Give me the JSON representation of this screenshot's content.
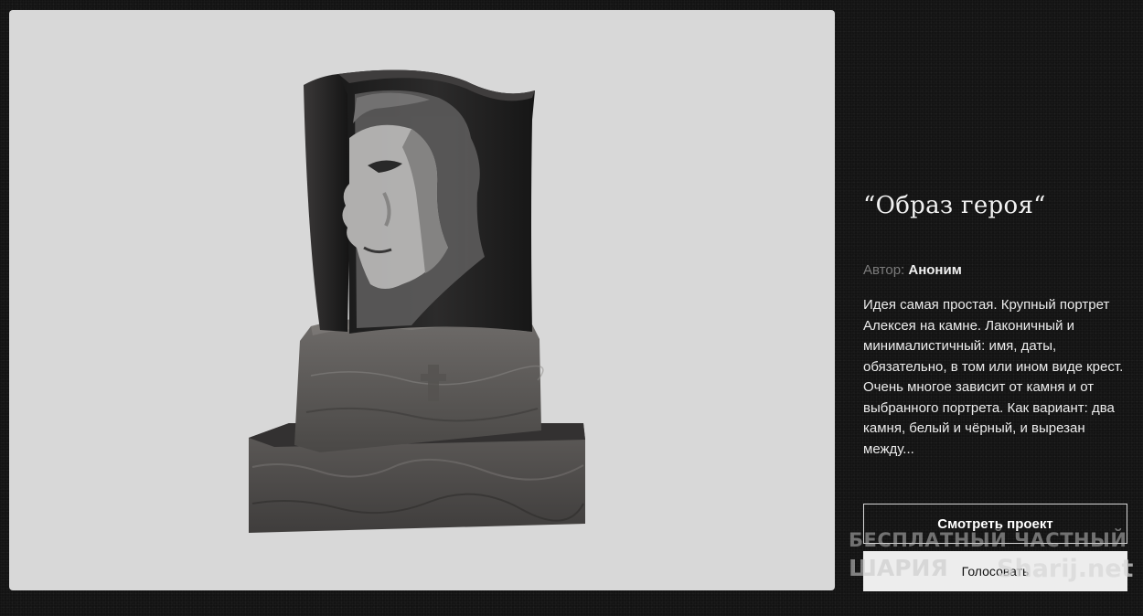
{
  "project": {
    "title": "“Образ героя“",
    "author_label": "Автор:",
    "author_name": "Аноним",
    "description": "Идея самая простая. Крупный портрет Алексея на камне. Лаконичный и минималистичный: имя, даты, обязательно, в том или ином виде крест. Очень многое зависит от камня и от выбранного портрета. Как вариант: два камня, белый и чёрный, и вырезан между..."
  },
  "actions": {
    "view_label": "Смотреть проект",
    "vote_label": "Голосовать"
  },
  "watermark": {
    "line1": "БЕСПЛАТНЫЙ ЧАСТНЫЙ",
    "line2": "ШАРИЯ",
    "domain": "Sharij.net"
  },
  "colors": {
    "page_background": "#131313",
    "image_background": "#d8d8d8",
    "text_primary": "#f2f2f2",
    "text_muted": "#7b7b7b"
  }
}
